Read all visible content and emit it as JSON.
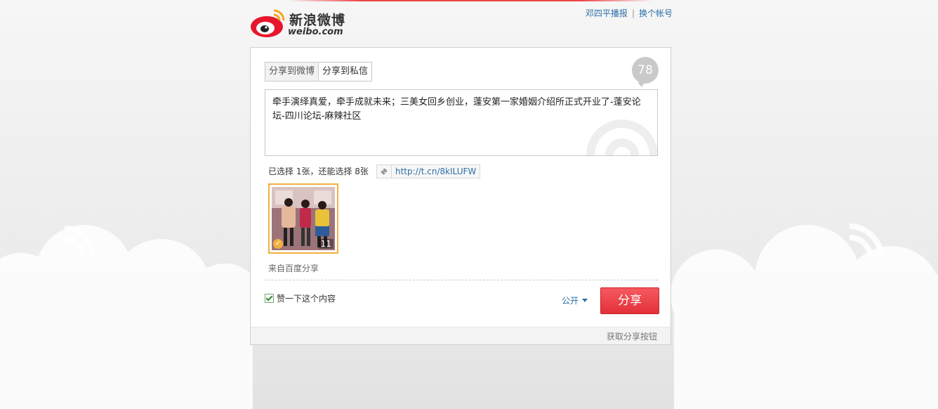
{
  "header": {
    "logo_cn": "新浪微博",
    "logo_en": "weibo.com",
    "user_link": "邓四平播报",
    "switch_account": "换个帐号",
    "separator": "|"
  },
  "tabs": [
    {
      "label": "分享到微博",
      "active": true
    },
    {
      "label": "分享到私信",
      "active": false
    }
  ],
  "remaining_chars": "78",
  "message": "牵手演绎真爱，牵手成就未来；三美女回乡创业，蓬安第一家婚姻介绍所正式开业了-蓬安论坛-四川论坛-麻辣社区",
  "image_selection": {
    "text": "已选择 1张，还能选择 8张"
  },
  "short_url": "http://t.cn/8kILUFW",
  "thumbnail": {
    "count": "11",
    "selected": true
  },
  "source": "来自百度分享",
  "like_checkbox": {
    "label": "赞一下这个内容",
    "checked": true
  },
  "privacy": "公开",
  "share_button": "分享",
  "footer_link": "获取分享按钮",
  "colors": {
    "accent_red": "#e3303a",
    "link_blue": "#2d6fa8",
    "thumb_border": "#f0b040"
  },
  "icons": [
    "weibo-logo-icon",
    "link-icon",
    "check-icon",
    "caret-down-icon"
  ]
}
